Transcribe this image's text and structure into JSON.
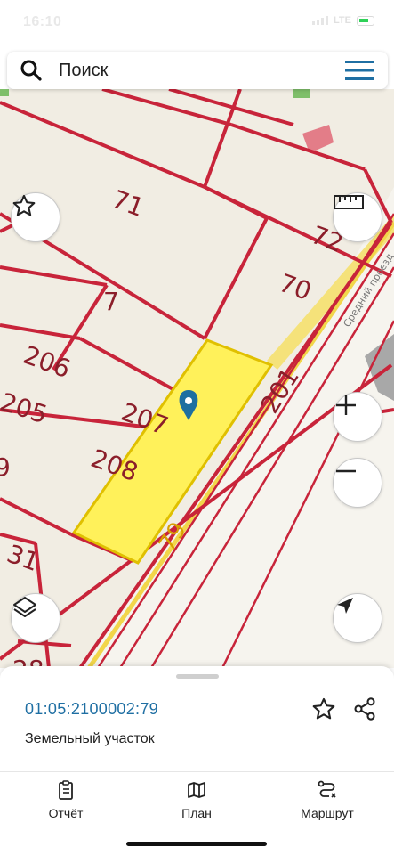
{
  "status_bar": {
    "time": "16:10",
    "network": "LTE"
  },
  "search": {
    "placeholder": "Поиск"
  },
  "map": {
    "plot_labels": [
      "71",
      "72",
      "7",
      "70",
      "206",
      "201",
      "205",
      "207",
      "208",
      "9",
      "31",
      "28",
      "79"
    ],
    "selected_plot": "79",
    "road_label": "Средний проезд",
    "colors": {
      "boundary": "#c8243a",
      "selected_fill": "#fff15a",
      "selected_border": "#e4c800",
      "road": "#f5e27a",
      "marker": "#1e6fa0"
    }
  },
  "sheet": {
    "cadastral_number": "01:05:2100002:79",
    "type": "Земельный участок"
  },
  "nav": {
    "report": "Отчёт",
    "plan": "План",
    "route": "Маршрут"
  }
}
